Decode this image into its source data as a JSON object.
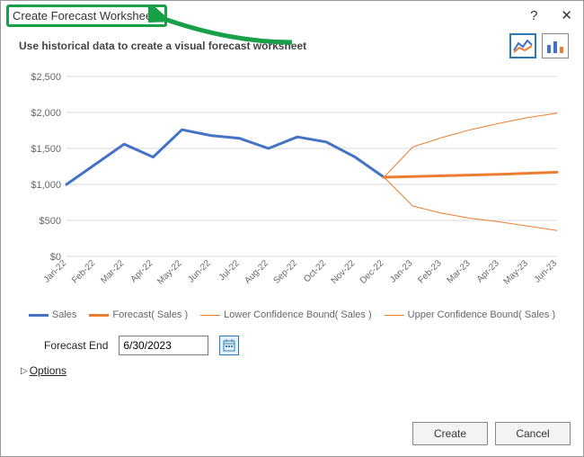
{
  "dialog": {
    "title": "Create Forecast Worksheet",
    "subtitle": "Use historical data to create a visual forecast worksheet",
    "help_symbol": "?",
    "close_symbol": "✕"
  },
  "forecast_end": {
    "label": "Forecast End",
    "value": "6/30/2023"
  },
  "options": {
    "label": "Options"
  },
  "buttons": {
    "create": "Create",
    "cancel": "Cancel"
  },
  "legend": {
    "sales": "Sales",
    "forecast": "Forecast( Sales )",
    "lower": "Lower Confidence Bound( Sales )",
    "upper": "Upper Confidence Bound( Sales )"
  },
  "colors": {
    "sales": "#4472c4",
    "forecast": "#ed7d31",
    "bound": "#ed7d31",
    "highlight": "#18a048"
  },
  "chart_data": {
    "type": "line",
    "title": "",
    "xlabel": "",
    "ylabel": "",
    "ylim": [
      0,
      2500
    ],
    "y_ticks": [
      0,
      500,
      1000,
      1500,
      2000,
      2500
    ],
    "y_tick_labels": [
      "$0",
      "$500",
      "$1,000",
      "$1,500",
      "$2,000",
      "$2,500"
    ],
    "categories": [
      "Jan-22",
      "Feb-22",
      "Mar-22",
      "Apr-22",
      "May-22",
      "Jun-22",
      "Jul-22",
      "Aug-22",
      "Sep-22",
      "Oct-22",
      "Nov-22",
      "Dec-22",
      "Jan-23",
      "Feb-23",
      "Mar-23",
      "Apr-23",
      "May-23",
      "Jun-23"
    ],
    "series": [
      {
        "name": "Sales",
        "color": "#4472c4",
        "width": 3,
        "values": [
          1000,
          1280,
          1560,
          1380,
          1760,
          1680,
          1640,
          1500,
          1660,
          1590,
          1380,
          1100,
          null,
          null,
          null,
          null,
          null,
          null
        ]
      },
      {
        "name": "Forecast( Sales )",
        "color": "#ed7d31",
        "width": 3,
        "values": [
          null,
          null,
          null,
          null,
          null,
          null,
          null,
          null,
          null,
          null,
          null,
          1100,
          1110,
          1120,
          1130,
          1140,
          1155,
          1170
        ]
      },
      {
        "name": "Lower Confidence Bound( Sales )",
        "color": "#ed7d31",
        "width": 1,
        "values": [
          null,
          null,
          null,
          null,
          null,
          null,
          null,
          null,
          null,
          null,
          null,
          1100,
          700,
          600,
          530,
          480,
          420,
          360
        ]
      },
      {
        "name": "Upper Confidence Bound( Sales )",
        "color": "#ed7d31",
        "width": 1,
        "values": [
          null,
          null,
          null,
          null,
          null,
          null,
          null,
          null,
          null,
          null,
          null,
          1100,
          1520,
          1650,
          1760,
          1850,
          1930,
          1990
        ]
      }
    ]
  }
}
